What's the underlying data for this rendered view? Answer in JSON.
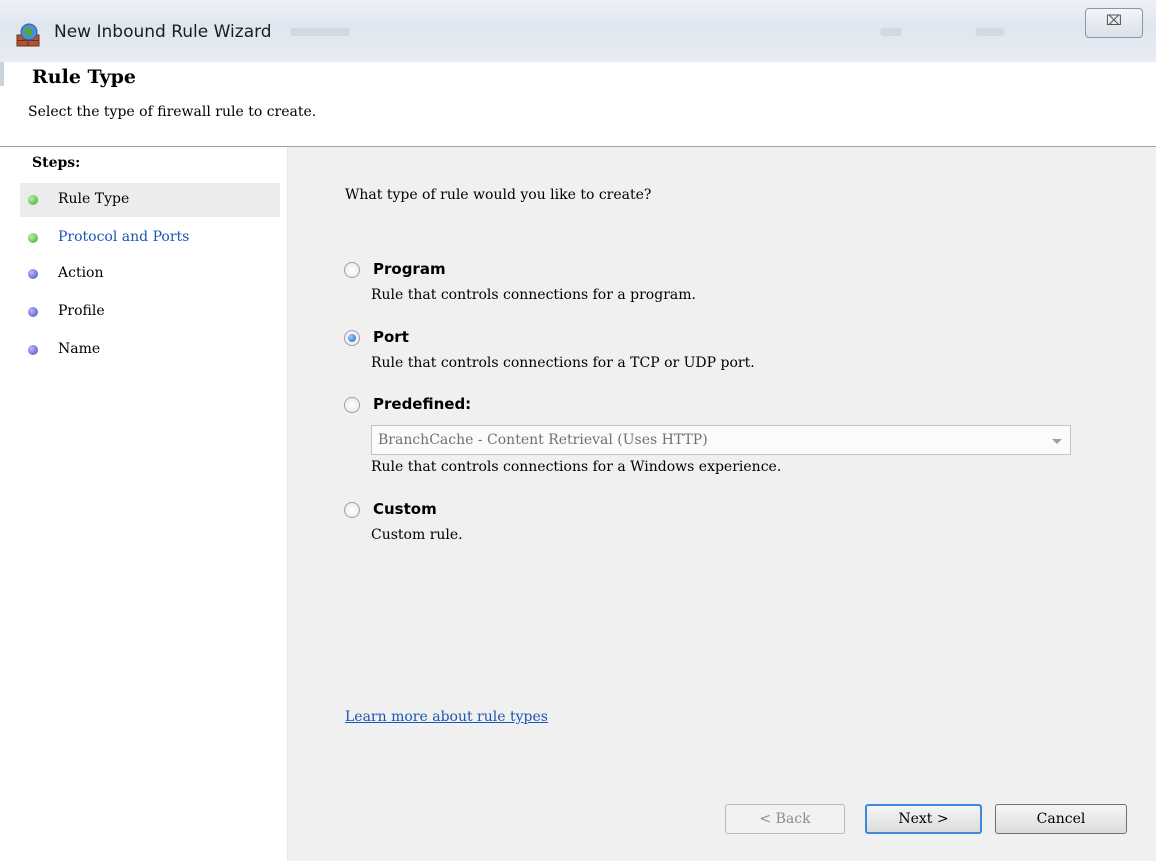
{
  "window": {
    "title": "New Inbound Rule Wizard",
    "close_symbol": "⌧"
  },
  "header": {
    "title": "Rule Type",
    "subtitle": "Select the type of firewall rule to create."
  },
  "steps": {
    "heading": "Steps:",
    "items": [
      {
        "label": "Rule Type",
        "state": "current",
        "dot": "green"
      },
      {
        "label": "Protocol and Ports",
        "state": "link",
        "dot": "green"
      },
      {
        "label": "Action",
        "state": "pending",
        "dot": "blue"
      },
      {
        "label": "Profile",
        "state": "pending",
        "dot": "blue"
      },
      {
        "label": "Name",
        "state": "pending",
        "dot": "blue"
      }
    ]
  },
  "content": {
    "question": "What type of rule would you like to create?",
    "options": [
      {
        "label": "Program",
        "description": "Rule that controls connections for a program.",
        "checked": false
      },
      {
        "label": "Port",
        "description": "Rule that controls connections for a TCP or UDP port.",
        "checked": true
      },
      {
        "label": "Predefined:",
        "description": "Rule that controls connections for a Windows experience.",
        "checked": false
      },
      {
        "label": "Custom",
        "description": "Custom rule.",
        "checked": false
      }
    ],
    "predefined_select": {
      "value": "BranchCache - Content Retrieval (Uses HTTP)",
      "disabled": true
    },
    "learn_more": "Learn more about rule types"
  },
  "buttons": {
    "back": "< Back",
    "next": "Next >",
    "cancel": "Cancel"
  },
  "colors": {
    "link": "#1a55b5",
    "content_bg": "#f0f0f0",
    "step_highlight": "#ececec"
  }
}
